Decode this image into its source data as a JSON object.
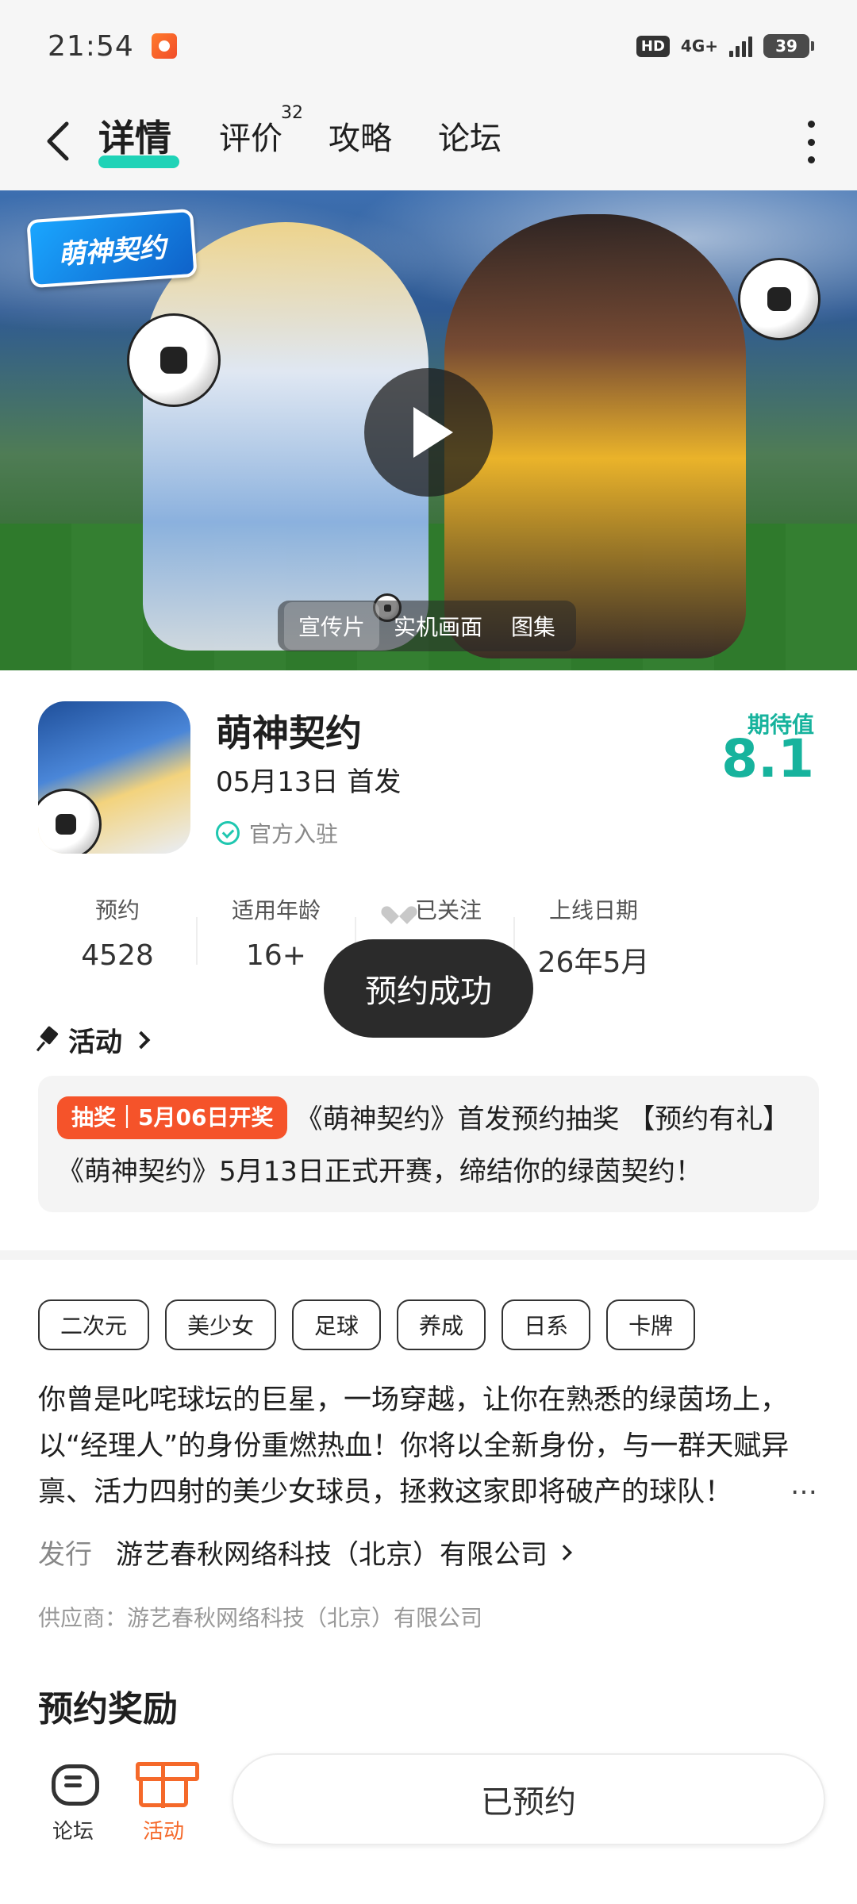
{
  "status_bar": {
    "time": "21:54",
    "hd": "HD",
    "network": "4G+",
    "battery": "39"
  },
  "nav": {
    "tabs": [
      {
        "label": "详情",
        "active": true
      },
      {
        "label": "评价",
        "badge": "32"
      },
      {
        "label": "攻略"
      },
      {
        "label": "论坛"
      }
    ]
  },
  "banner": {
    "logo_text": "萌神契约",
    "media_tabs": [
      "宣传片",
      "实机画面",
      "图集"
    ],
    "selected_media_tab": "宣传片"
  },
  "game": {
    "title": "萌神契约",
    "release": "05月13日 首发",
    "official": "官方入驻",
    "expect_label": "期待值",
    "expect_value": "8.1"
  },
  "stats": [
    {
      "label": "预约",
      "value": "4528"
    },
    {
      "label": "适用年龄",
      "value": "16+"
    },
    {
      "label": "已关注",
      "value": ""
    },
    {
      "label": "上线日期",
      "value": "26年5月"
    }
  ],
  "toast": "预约成功",
  "activity": {
    "heading": "活动",
    "badge": "抽奖｜5月06日开奖",
    "text": "《萌神契约》首发预约抽奖 【预约有礼】《萌神契约》5月13日正式开赛，缔结你的绿茵契约！"
  },
  "tags": [
    "二次元",
    "美少女",
    "足球",
    "养成",
    "日系",
    "卡牌"
  ],
  "description": "你曾是叱咤球坛的巨星，一场穿越，让你在熟悉的绿茵场上，以“经理人”的身份重燃热血！你将以全新身份，与一群天赋异禀、活力四射的美少女球员，拯救这家即将破产的球队！",
  "description_more": "…",
  "publisher": {
    "label": "发行",
    "name": "游艺春秋网络科技（北京）有限公司"
  },
  "supplier": "供应商：游艺春秋网络科技（北京）有限公司",
  "reward_title": "预约奖励",
  "bottom_bar": {
    "forum_label": "论坛",
    "activity_label": "活动",
    "reserve_button": "已预约"
  },
  "colors": {
    "accent_teal": "#1fd3b7",
    "expect_teal": "#17b39d",
    "lottery_orange": "#f5532a",
    "activity_orange": "#f5692a"
  }
}
